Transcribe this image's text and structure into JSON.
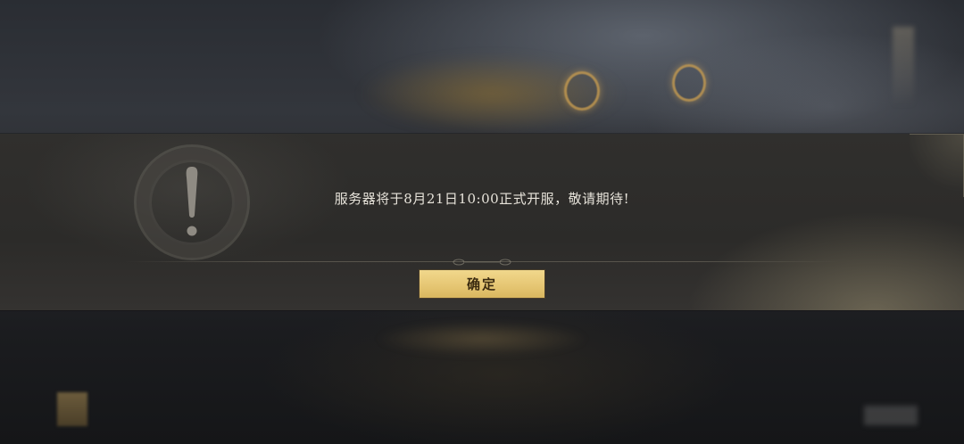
{
  "dialog": {
    "message": "服务器将于8月21日10:00正式开服，敬请期待!",
    "confirm_label": "确定",
    "icon": "exclamation-warning-icon"
  },
  "colors": {
    "button_gold": "#e6c774",
    "button_text": "#3a2a10",
    "message_text": "#e7e3da",
    "dialog_background": "#2e2d2b"
  }
}
